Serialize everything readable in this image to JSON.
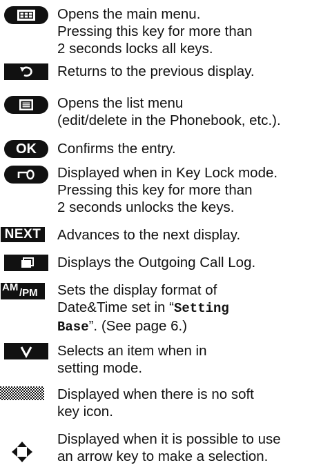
{
  "entries": [
    {
      "icon": "menu-key-icon",
      "text": "Opens the main menu.\nPressing this key for more than\n2 seconds locks all keys."
    },
    {
      "icon": "back-key-icon",
      "text": "Returns to the previous display."
    },
    {
      "icon": "list-menu-key-icon",
      "text": "Opens the list menu\n(edit/delete in the Phonebook, etc.)."
    },
    {
      "icon": "ok-key-icon",
      "label": "OK",
      "text": "Confirms the entry."
    },
    {
      "icon": "key-lock-icon",
      "text": "Displayed when in Key Lock mode.\nPressing this key for more than\n2 seconds unlocks the keys."
    },
    {
      "icon": "next-key-icon",
      "label": "NEXT",
      "text": "Advances to the next display."
    },
    {
      "icon": "outgoing-call-log-icon",
      "text": "Displays the Outgoing Call Log."
    },
    {
      "icon": "am-pm-key-icon",
      "label_am": "AM",
      "label_pm": "/PM",
      "text_a": "Sets the display format of\nDate&Time set in “",
      "mono_a": "Setting",
      "mono_b": "Base",
      "text_b": "”. (See page 6.)"
    },
    {
      "icon": "select-check-icon",
      "text": "Selects an item when in\nsetting mode."
    },
    {
      "icon": "no-soft-key-icon",
      "text": "Displayed when there is no soft\nkey icon."
    },
    {
      "icon": "arrow-key-icon",
      "text": "Displayed when it is possible to use\nan arrow key to make a selection."
    }
  ]
}
